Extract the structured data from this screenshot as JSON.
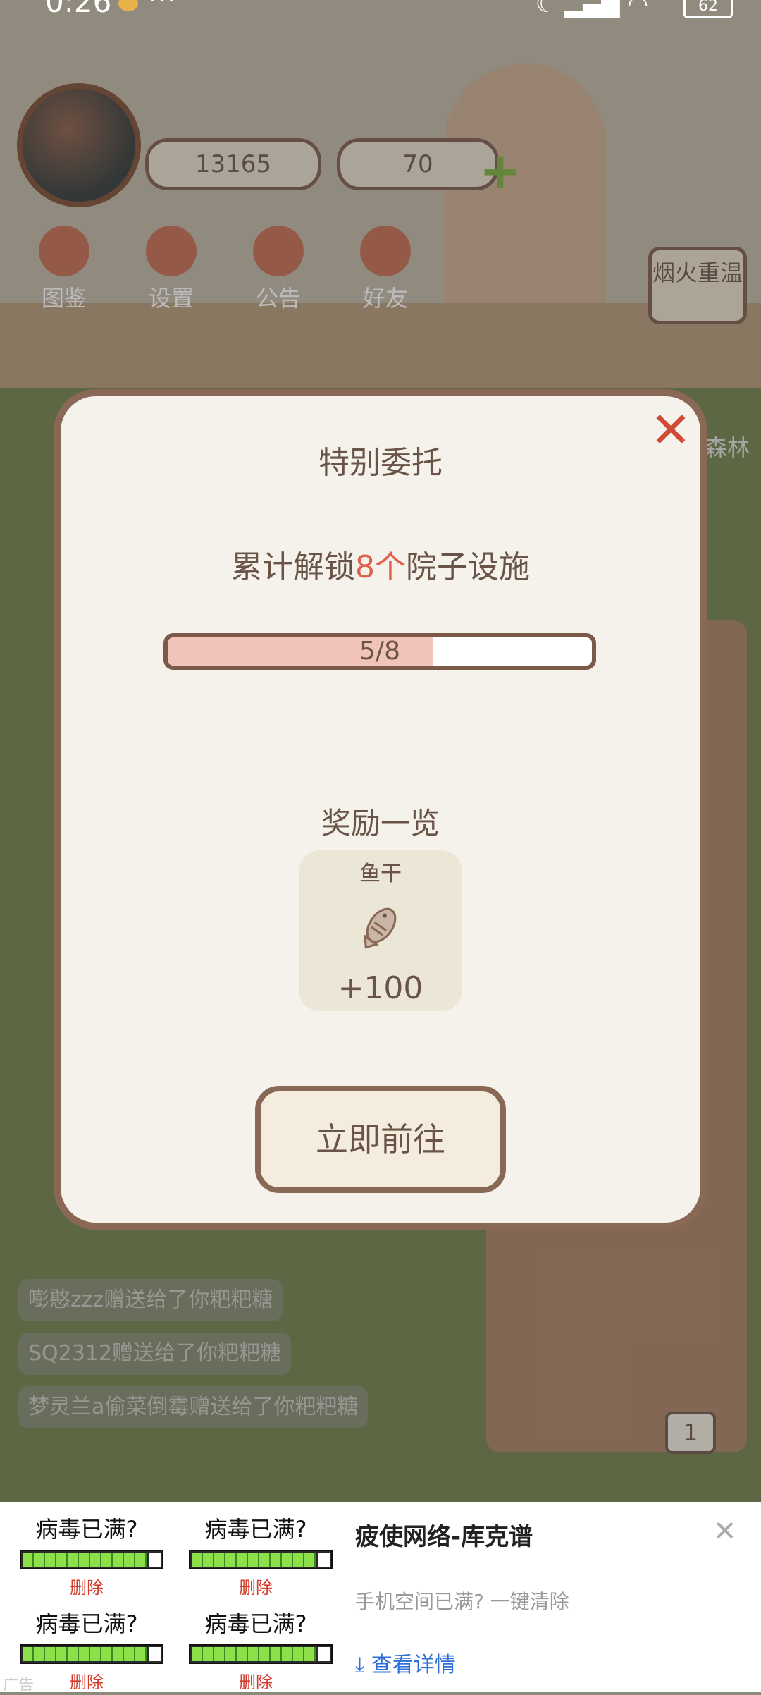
{
  "status_bar": {
    "time": "0:26",
    "extra": "···",
    "network": "4G",
    "battery": "62"
  },
  "hud": {
    "fish_count": "13165",
    "heart_count": "70",
    "plus": "+",
    "menu": [
      {
        "label": "图鉴",
        "icon": "cat-face-icon"
      },
      {
        "label": "设置",
        "icon": "gear-icon"
      },
      {
        "label": "公告",
        "icon": "gift-icon"
      },
      {
        "label": "好友",
        "icon": "friends-icon"
      }
    ],
    "side_badge": "烟火重温",
    "side_badge_2": "森林"
  },
  "chat": [
    "嘭憨zzz赠送给了你粑粑糖",
    "SQ2312赠送给了你粑粑糖",
    "梦灵兰a偷菜倒霉赠送给了你粑粑糖"
  ],
  "garden_counter": "1",
  "modal": {
    "title": "特别委托",
    "task_prefix": "累计解锁",
    "task_highlight": "8个",
    "task_suffix": "院子设施",
    "progress_text": "5/8",
    "progress_value": 5,
    "progress_max": 8,
    "reward_heading": "奖励一览",
    "reward": {
      "name": "鱼干",
      "amount": "+100",
      "icon": "dried-fish-icon"
    },
    "go_button": "立即前往",
    "close": "✕"
  },
  "ad": {
    "thumbs": [
      {
        "question": "病毒已满?",
        "delete": "删除"
      },
      {
        "question": "病毒已满?",
        "delete": "删除"
      },
      {
        "question": "病毒已满?",
        "delete": "删除"
      },
      {
        "question": "病毒已满?",
        "delete": "删除"
      }
    ],
    "title": "疲使网络-库克谱",
    "description": "手机空间已满? 一键清除",
    "link": "查看详情",
    "close": "✕",
    "marker": "广告"
  },
  "colors": {
    "modal_bg": "#f5f1eb",
    "border": "#8a6856",
    "highlight": "#e0624c",
    "progress_fill": "#f2c3b8",
    "link": "#2d6fd6"
  }
}
